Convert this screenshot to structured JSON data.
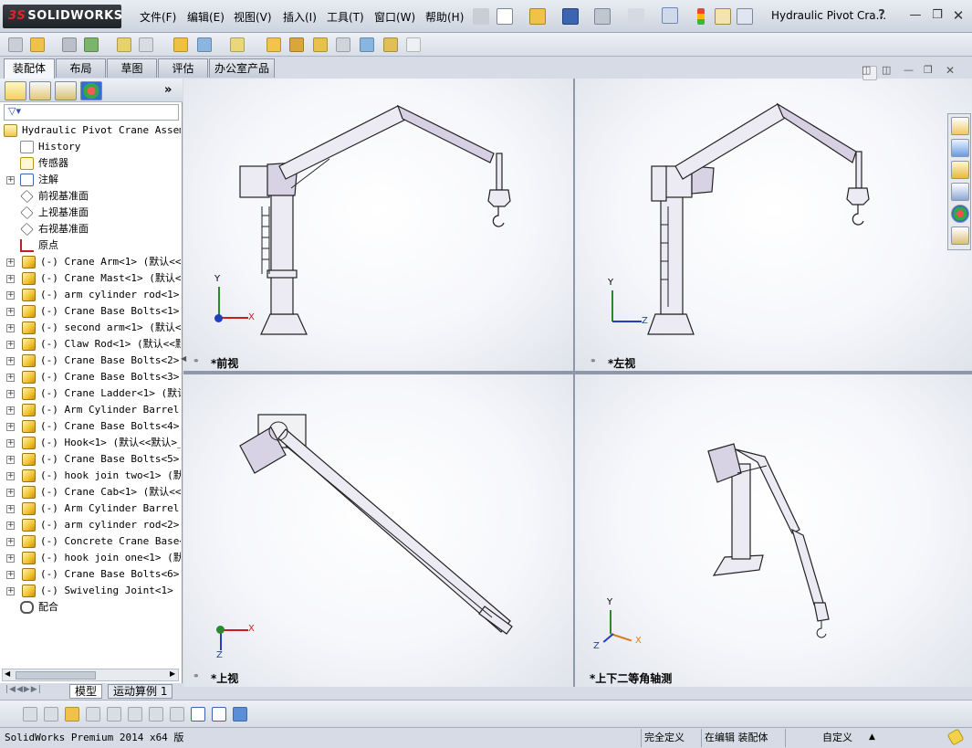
{
  "app": {
    "brand": "SOLIDWORKS",
    "brand_mark": "3S",
    "document_title": "Hydraulic Pivot Cra...",
    "help_label": "?"
  },
  "menu": [
    {
      "label": "文件(F)"
    },
    {
      "label": "编辑(E)"
    },
    {
      "label": "视图(V)"
    },
    {
      "label": "插入(I)"
    },
    {
      "label": "工具(T)"
    },
    {
      "label": "窗口(W)"
    },
    {
      "label": "帮助(H)"
    }
  ],
  "command_tabs": [
    {
      "label": "装配体",
      "active": true
    },
    {
      "label": "布局",
      "active": false
    },
    {
      "label": "草图",
      "active": false
    },
    {
      "label": "评估",
      "active": false
    },
    {
      "label": "办公室产品",
      "active": false
    }
  ],
  "feature_tree": {
    "root": "Hydraulic Pivot Crane Assembl",
    "items": [
      {
        "label": "History",
        "icon": "history-icon",
        "expandable": false
      },
      {
        "label": "传感器",
        "icon": "sensor-icon",
        "expandable": false
      },
      {
        "label": "注解",
        "icon": "annotation-icon",
        "expandable": true
      },
      {
        "label": "前视基准面",
        "icon": "plane-icon",
        "expandable": false
      },
      {
        "label": "上视基准面",
        "icon": "plane-icon",
        "expandable": false
      },
      {
        "label": "右视基准面",
        "icon": "plane-icon",
        "expandable": false
      },
      {
        "label": "原点",
        "icon": "origin-icon",
        "expandable": false
      },
      {
        "label": "(-) Crane Arm<1> (默认<<默",
        "icon": "part-icon",
        "expandable": true
      },
      {
        "label": "(-) Crane Mast<1> (默认<<",
        "icon": "part-icon",
        "expandable": true
      },
      {
        "label": "(-) arm cylinder rod<1> (",
        "icon": "part-icon",
        "expandable": true
      },
      {
        "label": "(-) Crane Base Bolts<1> (",
        "icon": "part-icon",
        "expandable": true
      },
      {
        "label": "(-) second arm<1> (默认<<",
        "icon": "part-icon",
        "expandable": true
      },
      {
        "label": "(-) Claw Rod<1> (默认<<默认",
        "icon": "part-icon",
        "expandable": true
      },
      {
        "label": "(-) Crane Base Bolts<2> (",
        "icon": "part-icon",
        "expandable": true
      },
      {
        "label": "(-) Crane Base Bolts<3> (",
        "icon": "part-icon",
        "expandable": true
      },
      {
        "label": "(-) Crane Ladder<1> (默认",
        "icon": "part-icon",
        "expandable": true
      },
      {
        "label": "(-) Arm Cylinder Barrel 1",
        "icon": "part-icon",
        "expandable": true
      },
      {
        "label": "(-) Crane Base Bolts<4> (",
        "icon": "part-icon",
        "expandable": true
      },
      {
        "label": "(-) Hook<1> (默认<<默认>_",
        "icon": "part-icon",
        "expandable": true
      },
      {
        "label": "(-) Crane Base Bolts<5> (",
        "icon": "part-icon",
        "expandable": true
      },
      {
        "label": "(-) hook join two<1> (默认",
        "icon": "part-icon",
        "expandable": true
      },
      {
        "label": "(-) Crane Cab<1> (默认<<默",
        "icon": "part-icon",
        "expandable": true
      },
      {
        "label": "(-) Arm Cylinder Barrel 1",
        "icon": "part-icon",
        "expandable": true
      },
      {
        "label": "(-) arm cylinder rod<2> (",
        "icon": "part-icon",
        "expandable": true
      },
      {
        "label": "(-) Concrete Crane Base<1",
        "icon": "part-icon",
        "expandable": true
      },
      {
        "label": "(-) hook join one<1> (默认",
        "icon": "part-icon",
        "expandable": true
      },
      {
        "label": "(-) Crane Base Bolts<6> (",
        "icon": "part-icon",
        "expandable": true
      },
      {
        "label": "(-) Swiveling Joint<1> (默",
        "icon": "part-icon",
        "expandable": true
      },
      {
        "label": "配合",
        "icon": "mates-icon",
        "expandable": false
      }
    ]
  },
  "bottom_tabs": [
    {
      "label": "模型"
    },
    {
      "label": "运动算例 1"
    }
  ],
  "viewports": {
    "front": {
      "label": "*前视"
    },
    "left": {
      "label": "*左视"
    },
    "top": {
      "label": "*上视"
    },
    "iso": {
      "label": "*上下二等角轴测"
    }
  },
  "axes": {
    "x": "X",
    "y": "Y",
    "z": "Z"
  },
  "status": {
    "version": "SolidWorks Premium 2014 x64 版",
    "definition": "完全定义",
    "mode": "在编辑 装配体",
    "units": "自定义",
    "units_arrow": "▲"
  },
  "colors": {
    "accent": "#0a4a9a",
    "part_yellow": "#f2c230",
    "axis_x": "#cc1d1d",
    "axis_y": "#2a8a2a",
    "axis_z": "#1f3fbf"
  }
}
